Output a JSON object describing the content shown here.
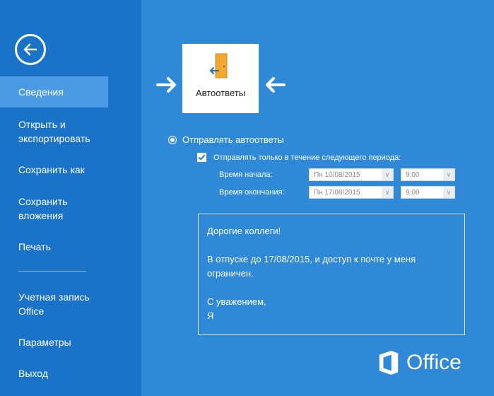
{
  "sidebar": {
    "items": [
      {
        "label": "Сведения"
      },
      {
        "label": "Открыть и экспортировать"
      },
      {
        "label": "Сохранить как"
      },
      {
        "label": "Сохранить вложения"
      },
      {
        "label": "Печать"
      },
      {
        "label": "Учетная запись Office"
      },
      {
        "label": "Параметры"
      },
      {
        "label": "Выход"
      }
    ]
  },
  "tile": {
    "label": "Автоответы",
    "icon": "door-exit-icon"
  },
  "autoreply": {
    "send_label": "Отправлять автоответы",
    "period_label": "Отправлять только в течение следующего периода:",
    "start_label": "Время начала:",
    "end_label": "Время окончания:",
    "start_date": "Пн  10/08/2015",
    "start_time": "9:00",
    "end_date": "Пн  17/08/2015",
    "end_time": "9:00"
  },
  "message": {
    "lines": [
      "Дорогие коллеги!",
      "",
      "В отпуске до 17/08/2015, и доступ к почте у меня ограничен.",
      "",
      "С уважением,",
      "Я"
    ]
  },
  "brand": {
    "name": "Office"
  },
  "colors": {
    "background": "#2f89d6",
    "sidebar": "#1a73c7",
    "active_item": "#4a9be4",
    "accent_orange": "#f0a830"
  }
}
